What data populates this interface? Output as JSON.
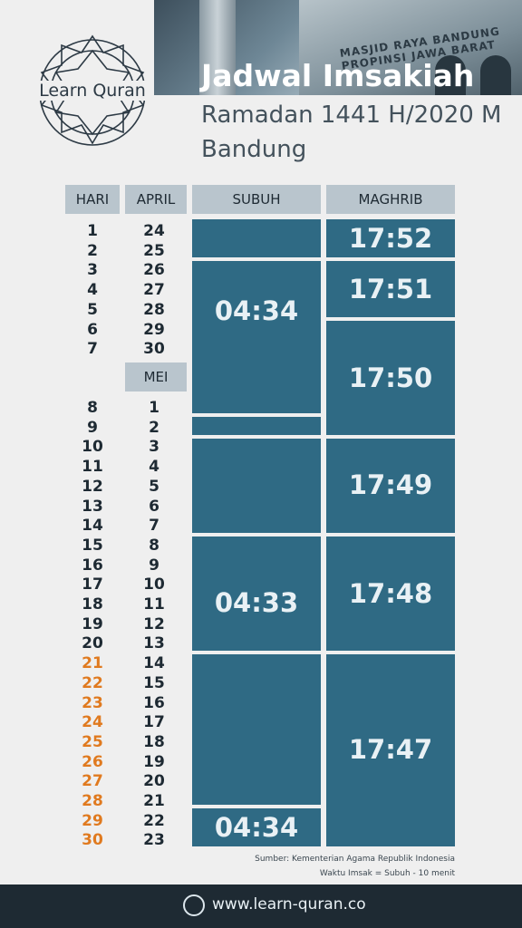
{
  "brand": {
    "logo_text": "Learn Quran",
    "photo_sign": "MASJID RAYA BANDUNG PROPINSI JAWA BARAT"
  },
  "header": {
    "title": "Jadwal Imsakiah",
    "subtitle": "Ramadan 1441 H/2020 M",
    "city": "Bandung"
  },
  "columns": {
    "hari": "HARI",
    "april": "APRIL",
    "subuh": "SUBUH",
    "maghrib": "MAGHRIB",
    "mei": "MEI"
  },
  "days": [
    "1",
    "2",
    "3",
    "4",
    "5",
    "6",
    "7",
    "8",
    "9",
    "10",
    "11",
    "12",
    "13",
    "14",
    "15",
    "16",
    "17",
    "18",
    "19",
    "20",
    "21",
    "22",
    "23",
    "24",
    "25",
    "26",
    "27",
    "28",
    "29",
    "30"
  ],
  "dates": [
    "24",
    "25",
    "26",
    "27",
    "28",
    "29",
    "30",
    "1",
    "2",
    "3",
    "4",
    "5",
    "6",
    "7",
    "8",
    "9",
    "10",
    "11",
    "12",
    "13",
    "14",
    "15",
    "16",
    "17",
    "18",
    "19",
    "20",
    "21",
    "22",
    "23"
  ],
  "subuh_times": [
    "04:34",
    "04:33",
    "04:34"
  ],
  "maghrib_times": [
    "17:52",
    "17:51",
    "17:50",
    "17:49",
    "17:48",
    "17:47"
  ],
  "footer": {
    "source": "Sumber: Kementerian Agama Republik Indonesia",
    "note": "Waktu Imsak = Subuh - 10 menit",
    "url": "www.learn-quran.co"
  },
  "colors": {
    "accent_days": "#e07a1f",
    "block": "#2f6a84",
    "header_cell": "#b9c5cd",
    "footer": "#1e2a33"
  }
}
